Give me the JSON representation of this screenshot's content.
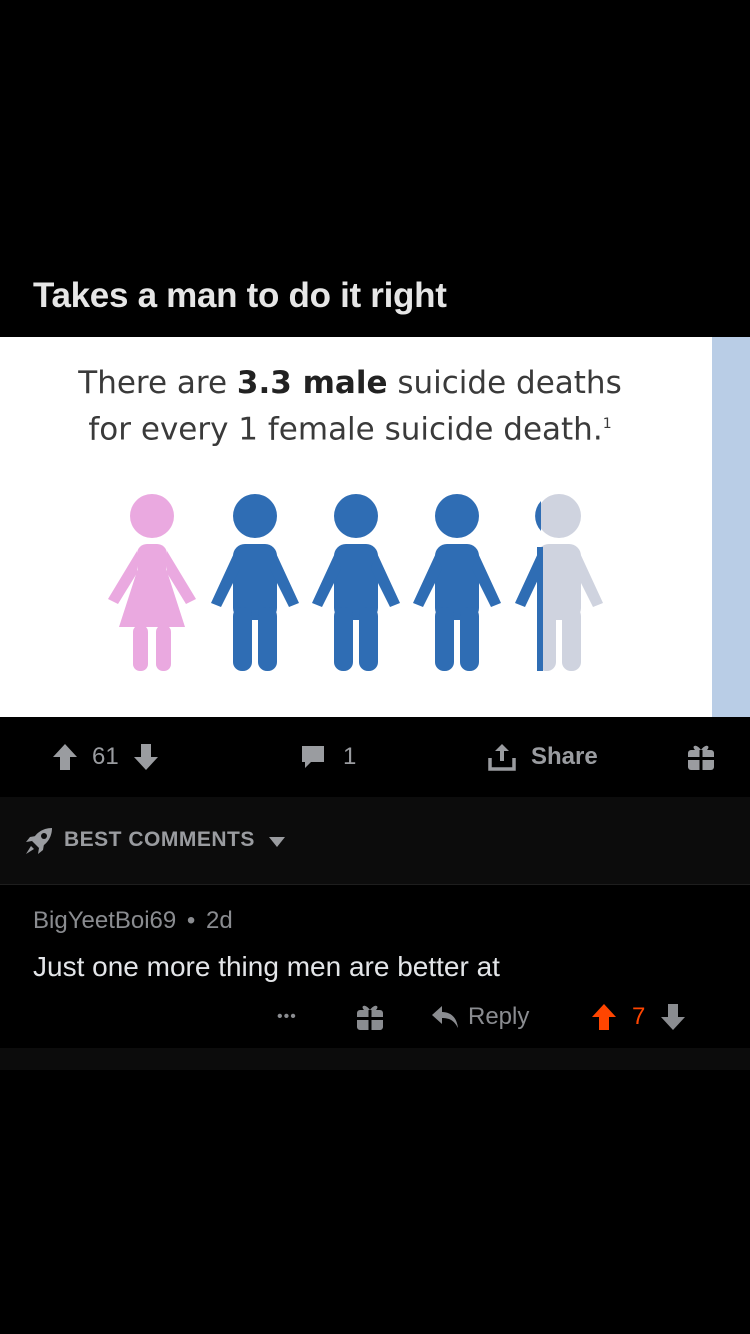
{
  "post": {
    "title": "Takes a man to do it right"
  },
  "image": {
    "text_line1_pre": "There are ",
    "text_line1_bold": "3.3 male",
    "text_line1_post": " suicide deaths",
    "text_line2": "for every 1 female suicide death.",
    "text_footnote": "1",
    "figures": [
      "female-pink",
      "male-blue",
      "male-blue",
      "male-blue",
      "male-partial"
    ],
    "colors": {
      "female": "#eaa9e0",
      "male": "#2f6db4",
      "faded": "#cfd3df",
      "stripe": "#b9cde6"
    }
  },
  "actions": {
    "upvotes": "61",
    "comments": "1",
    "share_label": "Share"
  },
  "comments_section": {
    "sort_label": "BEST COMMENTS"
  },
  "comment": {
    "author": "BigYeetBoi69",
    "separator": "•",
    "age": "2d",
    "body": "Just one more thing men are better at",
    "more": "•••",
    "reply_label": "Reply",
    "score": "7",
    "score_color": "#ff4500"
  }
}
